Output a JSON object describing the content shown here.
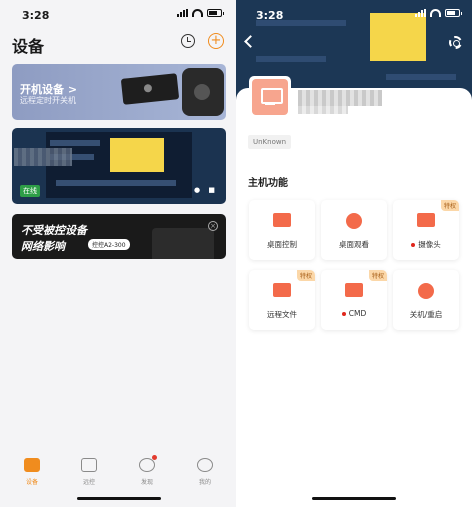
{
  "left": {
    "status_time": "3:28",
    "page_title": "设备",
    "banner1": {
      "title": "开机设备 >",
      "subtitle": "远程定时开关机"
    },
    "device_card": {
      "status_badge": "在线"
    },
    "banner2": {
      "line1": "不受被控设备",
      "line2": "网络影响",
      "pill": "控控A2-300"
    },
    "tabs": [
      {
        "label": "设备",
        "active": true
      },
      {
        "label": "远控",
        "active": false
      },
      {
        "label": "发现",
        "active": false
      },
      {
        "label": "我的",
        "active": false
      }
    ],
    "accent_color": "#f08c1e"
  },
  "right": {
    "status_time": "3:28",
    "os_tag": "UnKnown",
    "section_title": "主机功能",
    "features": [
      {
        "label": "桌面控制",
        "vip": "",
        "dot": false,
        "icon": "desktop-control-icon",
        "color": "#f36a4a"
      },
      {
        "label": "桌面观看",
        "vip": "",
        "dot": false,
        "icon": "eye-icon",
        "color": "#f36a4a"
      },
      {
        "label": "摄像头",
        "vip": "特权",
        "dot": true,
        "icon": "camera-icon",
        "color": "#f36a4a"
      },
      {
        "label": "远程文件",
        "vip": "特权",
        "dot": false,
        "icon": "folder-icon",
        "color": "#f36a4a"
      },
      {
        "label": "CMD",
        "vip": "特权",
        "dot": true,
        "icon": "cmd-icon",
        "color": "#f36a4a"
      },
      {
        "label": "关机/重启",
        "vip": "",
        "dot": false,
        "icon": "power-icon",
        "color": "#f36a4a"
      }
    ]
  }
}
